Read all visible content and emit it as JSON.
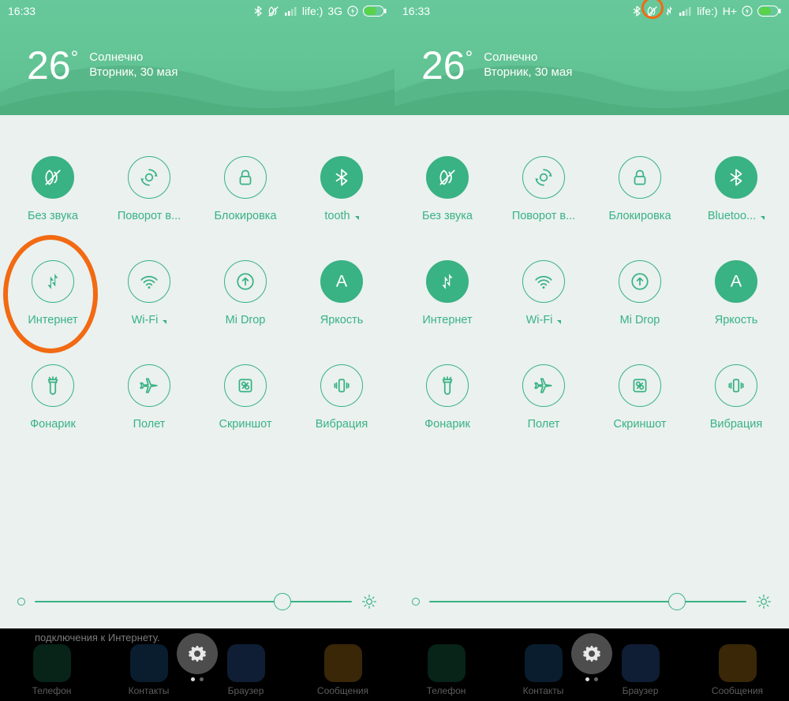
{
  "colors": {
    "accent": "#39b284",
    "highlight": "#f26a12"
  },
  "screens": [
    {
      "status": {
        "time": "16:33",
        "carrier": "life:)",
        "network": "3G",
        "data_arrows": false,
        "highlight_signal": false
      },
      "weather": {
        "temp": "26",
        "degree": "°",
        "condition": "Солнечно",
        "date": "Вторник, 30 мая"
      },
      "toggles": [
        {
          "id": "mute",
          "label": "Без звука",
          "on": true,
          "arrow": false
        },
        {
          "id": "rotate",
          "label": "Поворот в...",
          "on": false,
          "arrow": false
        },
        {
          "id": "lock",
          "label": "Блокировка",
          "on": false,
          "arrow": false
        },
        {
          "id": "bt",
          "label": "tooth",
          "on": true,
          "arrow": true
        },
        {
          "id": "data",
          "label": "Интернет",
          "on": false,
          "arrow": false,
          "highlight": true
        },
        {
          "id": "wifi",
          "label": "Wi-Fi",
          "on": false,
          "arrow": true
        },
        {
          "id": "midrop",
          "label": "Mi Drop",
          "on": false,
          "arrow": false
        },
        {
          "id": "bright",
          "label": "Яркость",
          "on": true,
          "arrow": false
        },
        {
          "id": "torch",
          "label": "Фонарик",
          "on": false,
          "arrow": false
        },
        {
          "id": "plane",
          "label": "Полет",
          "on": false,
          "arrow": false
        },
        {
          "id": "shot",
          "label": "Скриншот",
          "on": false,
          "arrow": false
        },
        {
          "id": "vibe",
          "label": "Вибрация",
          "on": false,
          "arrow": false
        }
      ],
      "brightness": {
        "value": 78
      },
      "dock": {
        "hint": "подключения к Интернету.",
        "apps": [
          "Телефон",
          "Контакты",
          "Браузер",
          "Сообщения"
        ],
        "app_colors": [
          "#1e8a5e",
          "#2374b7",
          "#3a77cf",
          "#e39a1f"
        ]
      }
    },
    {
      "status": {
        "time": "16:33",
        "carrier": "life:)",
        "network": "H+",
        "data_arrows": true,
        "highlight_signal": true
      },
      "weather": {
        "temp": "26",
        "degree": "°",
        "condition": "Солнечно",
        "date": "Вторник, 30 мая"
      },
      "toggles": [
        {
          "id": "mute",
          "label": "Без звука",
          "on": true,
          "arrow": false
        },
        {
          "id": "rotate",
          "label": "Поворот в...",
          "on": false,
          "arrow": false
        },
        {
          "id": "lock",
          "label": "Блокировка",
          "on": false,
          "arrow": false
        },
        {
          "id": "bt",
          "label": "Bluetoo...",
          "on": true,
          "arrow": true
        },
        {
          "id": "data",
          "label": "Интернет",
          "on": true,
          "arrow": false
        },
        {
          "id": "wifi",
          "label": "Wi-Fi",
          "on": false,
          "arrow": true
        },
        {
          "id": "midrop",
          "label": "Mi Drop",
          "on": false,
          "arrow": false
        },
        {
          "id": "bright",
          "label": "Яркость",
          "on": true,
          "arrow": false
        },
        {
          "id": "torch",
          "label": "Фонарик",
          "on": false,
          "arrow": false
        },
        {
          "id": "plane",
          "label": "Полет",
          "on": false,
          "arrow": false
        },
        {
          "id": "shot",
          "label": "Скриншот",
          "on": false,
          "arrow": false
        },
        {
          "id": "vibe",
          "label": "Вибрация",
          "on": false,
          "arrow": false
        }
      ],
      "brightness": {
        "value": 78
      },
      "dock": {
        "hint": "",
        "apps": [
          "Телефон",
          "Контакты",
          "Браузер",
          "Сообщения"
        ],
        "app_colors": [
          "#1e8a5e",
          "#2374b7",
          "#3a77cf",
          "#e39a1f"
        ]
      }
    }
  ]
}
